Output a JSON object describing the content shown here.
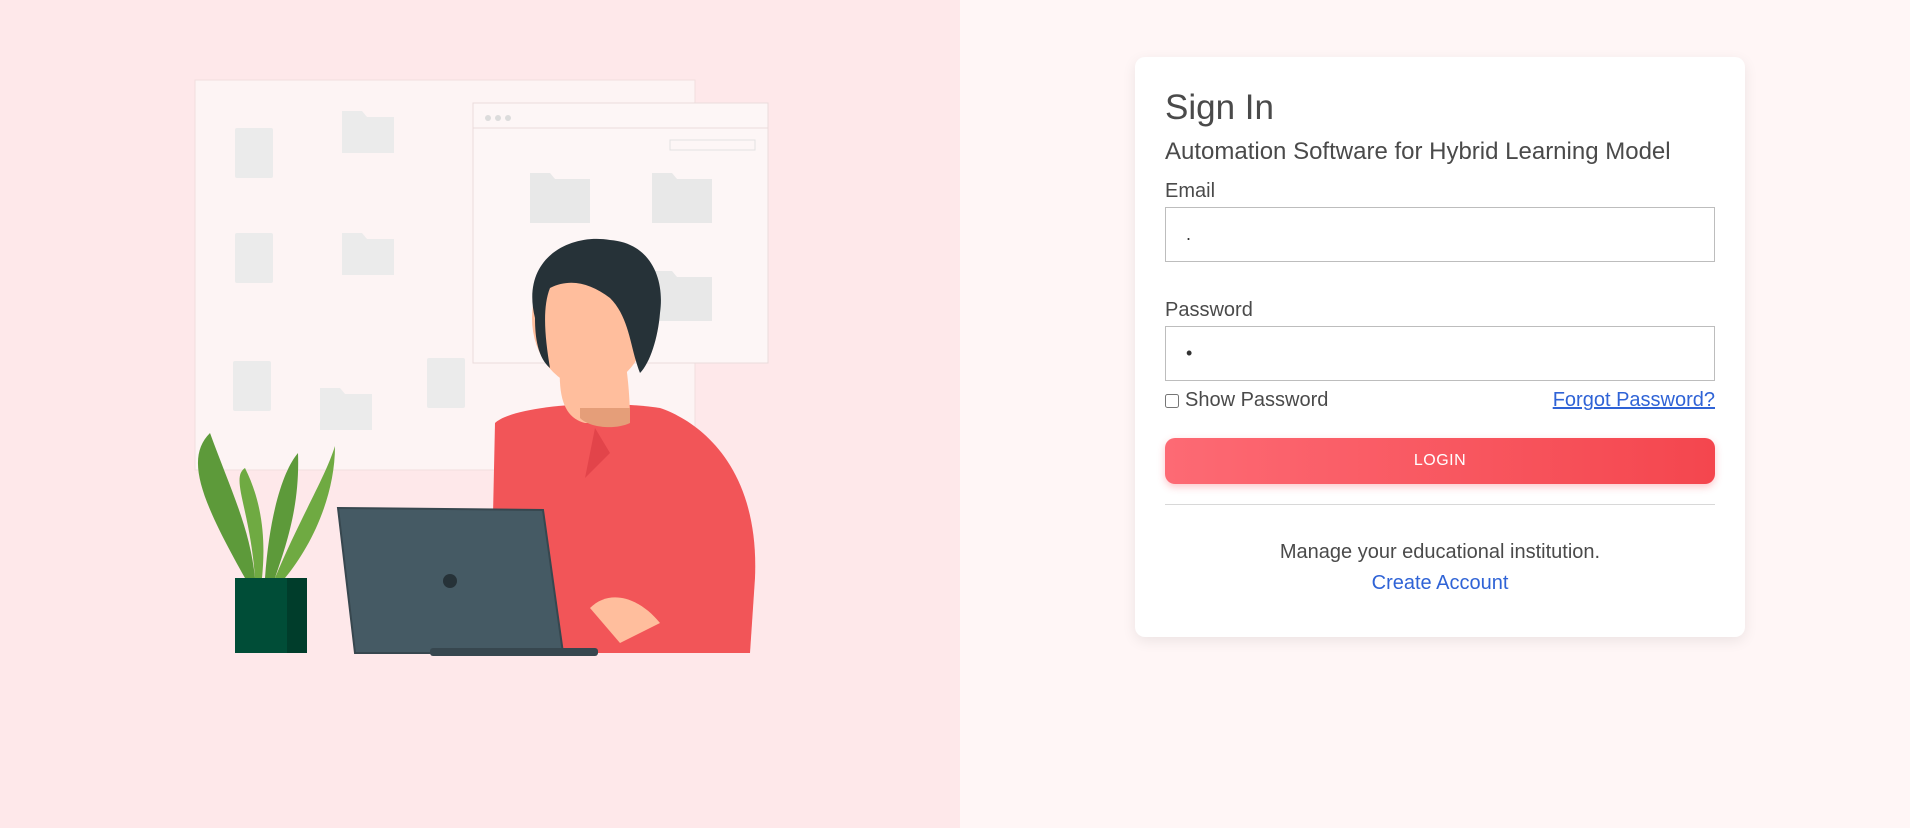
{
  "signin": {
    "title": "Sign In",
    "subtitle": "Automation Software for Hybrid Learning Model",
    "email_label": "Email",
    "email_value": ".",
    "password_label": "Password",
    "password_value": "•",
    "show_password_label": "Show Password",
    "show_password_checked": false,
    "forgot_password_label": "Forgot Password?",
    "login_label": "LOGIN",
    "footer_text": "Manage your educational institution.",
    "create_account_label": "Create Account"
  },
  "colors": {
    "left_background": "#fee8ea",
    "right_background": "#fff6f6",
    "accent": "#f4464e",
    "link": "#2f63d6"
  },
  "illustration": {
    "icons": [
      "folder-icon",
      "document-icon",
      "laptop-icon",
      "plant-icon"
    ]
  }
}
